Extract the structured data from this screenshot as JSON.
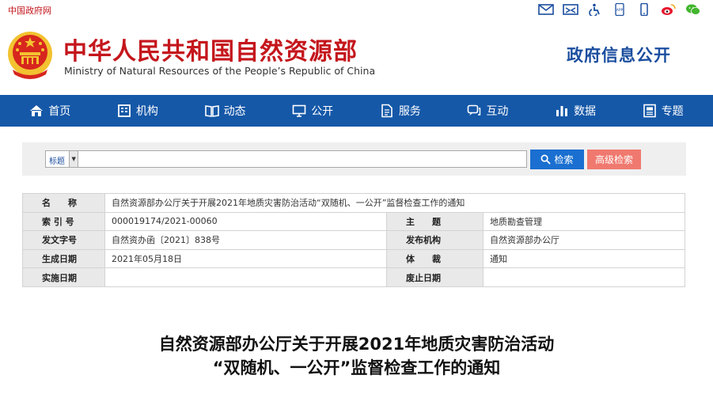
{
  "topbar": {
    "gov_link": "中国政府网",
    "icons": [
      "mail-icon",
      "message-icon",
      "accessibility-icon",
      "app-icon",
      "mobile-icon",
      "weibo-icon",
      "wechat-icon"
    ],
    "app_badge": "APP"
  },
  "header": {
    "ministry_cn": "中华人民共和国自然资源部",
    "ministry_en": "Ministry of Natural Resources of the People’s Republic of China",
    "section_title": "政府信息公开"
  },
  "nav": {
    "items": [
      {
        "label": "首页",
        "icon": "home-icon"
      },
      {
        "label": "机构",
        "icon": "organization-icon"
      },
      {
        "label": "动态",
        "icon": "book-icon"
      },
      {
        "label": "公开",
        "icon": "monitor-icon"
      },
      {
        "label": "服务",
        "icon": "document-icon"
      },
      {
        "label": "互动",
        "icon": "chat-icon"
      },
      {
        "label": "数据",
        "icon": "bar-chart-icon"
      },
      {
        "label": "专题",
        "icon": "topic-icon"
      }
    ]
  },
  "search": {
    "field_select": "标题",
    "query": "",
    "search_label": "检索",
    "advanced_label": "高级检索"
  },
  "info": {
    "name_label": "名　　称",
    "name_value": "自然资源部办公厅关于开展2021年地质灾害防治活动“双随机、一公开”监督检查工作的通知",
    "index_label": "索 引 号",
    "index_value": "000019174/2021-00060",
    "subject_label": "主　　题",
    "subject_value": "地质勘查管理",
    "docno_label": "发文字号",
    "docno_value": "自然资办函〔2021〕838号",
    "issuer_label": "发布机构",
    "issuer_value": "自然资源部办公厅",
    "date_label": "生成日期",
    "date_value": "2021年05月18日",
    "genre_label": "体　　裁",
    "genre_value": "通知",
    "effective_label": "实施日期",
    "effective_value": "",
    "expire_label": "废止日期",
    "expire_value": ""
  },
  "document": {
    "title_line1": "自然资源部办公厅关于开展2021年地质灾害防治活动",
    "title_line2": "“双随机、一公开”监督检查工作的通知"
  },
  "colors": {
    "brand_red": "#c4161c",
    "nav_blue": "#1558a8",
    "search_blue": "#1a6fd0",
    "advanced_pink": "#f0796f",
    "emblem_gold": "#f2c230"
  }
}
